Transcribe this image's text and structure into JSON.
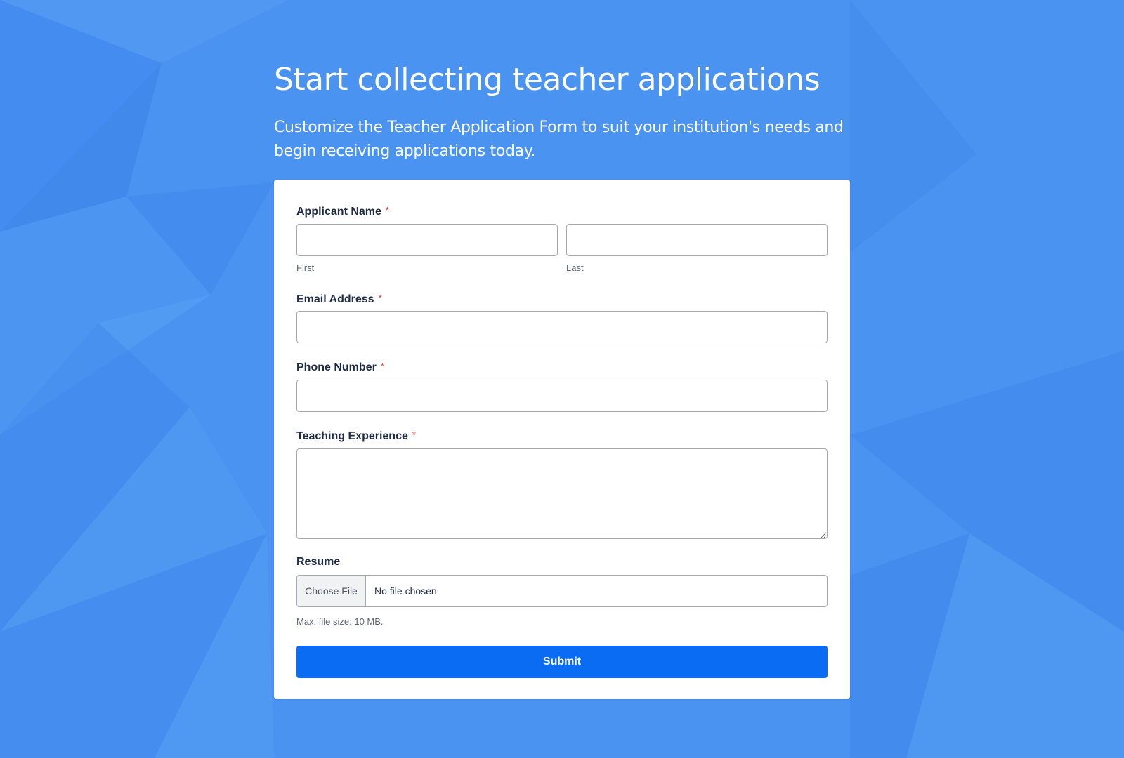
{
  "page": {
    "headline": "Start collecting teacher applications",
    "subheadline": "Customize the Teacher Application Form to suit your institution's needs and begin receiving applications today."
  },
  "form": {
    "required_marker": "*",
    "applicant_name": {
      "label": "Applicant Name",
      "first": {
        "value": "",
        "sublabel": "First"
      },
      "last": {
        "value": "",
        "sublabel": "Last"
      }
    },
    "email": {
      "label": "Email Address",
      "value": ""
    },
    "phone": {
      "label": "Phone Number",
      "value": ""
    },
    "experience": {
      "label": "Teaching Experience",
      "value": ""
    },
    "resume": {
      "label": "Resume",
      "button_label": "Choose File",
      "status": "No file chosen",
      "hint": "Max. file size: 10 MB."
    },
    "submit_label": "Submit"
  },
  "colors": {
    "background": "#4a93f1",
    "card": "#ffffff",
    "submit": "#0a6cf3",
    "required": "#e0342c",
    "label_text": "#1f2a44"
  }
}
